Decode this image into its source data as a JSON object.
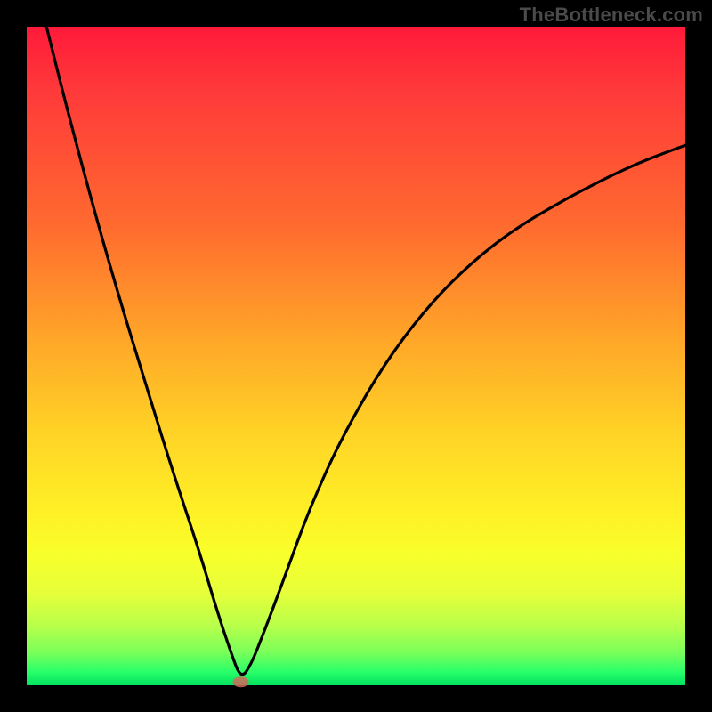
{
  "watermark": "TheBottleneck.com",
  "chart_data": {
    "type": "line",
    "title": "",
    "xlabel": "",
    "ylabel": "",
    "xlim": [
      0,
      100
    ],
    "ylim": [
      0,
      100
    ],
    "grid": false,
    "legend": false,
    "series": [
      {
        "name": "bottleneck-curve",
        "x": [
          3,
          6,
          10,
          14,
          18,
          22,
          26,
          29,
          31,
          32.5,
          34,
          36,
          39,
          43,
          48,
          55,
          63,
          72,
          82,
          92,
          100
        ],
        "values": [
          100,
          88,
          73,
          59,
          46,
          33,
          21,
          11,
          5,
          1,
          3,
          8,
          16,
          27,
          38,
          50,
          60,
          68,
          74,
          79,
          82
        ]
      }
    ],
    "annotations": [
      {
        "name": "minimum-marker",
        "x": 32.5,
        "y": 0.5
      }
    ]
  },
  "colors": {
    "frame": "#000000",
    "curve": "#000000",
    "minimum_marker": "#d16a5a",
    "gradient_top": "#ff1a3a",
    "gradient_bottom": "#00e060"
  }
}
